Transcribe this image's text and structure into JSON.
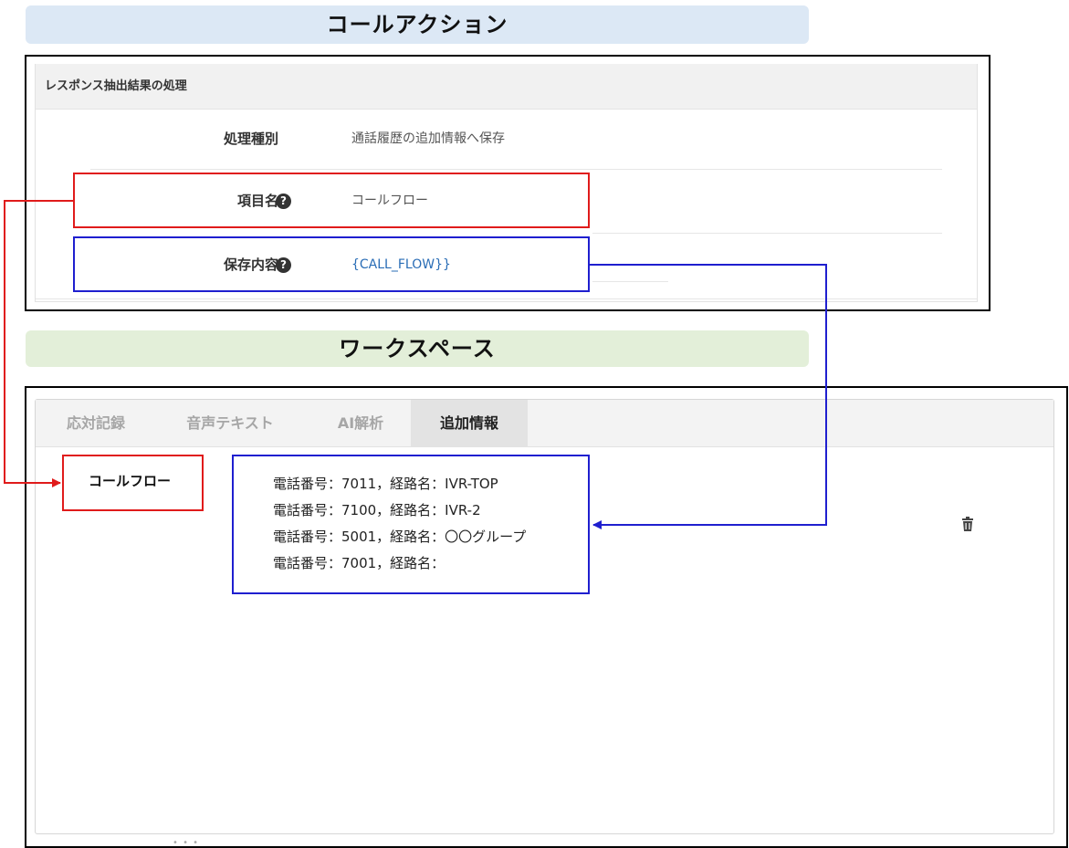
{
  "banners": {
    "call_action": "コールアクション",
    "workspace": "ワークスペース"
  },
  "settings": {
    "header": "レスポンス抽出結果の処理",
    "rows": [
      {
        "label": "処理種別",
        "value": "通話履歴の追加情報へ保存"
      },
      {
        "label": "項目名",
        "value": "コールフロー",
        "help_icon": "question-circle-icon"
      },
      {
        "label": "保存内容",
        "value": "{CALL_FLOW}}",
        "help_icon": "question-circle-icon"
      }
    ]
  },
  "workspace": {
    "tabs": [
      {
        "label": "応対記録",
        "active": false
      },
      {
        "label": "音声テキスト",
        "active": false
      },
      {
        "label": "AI解析",
        "active": false
      },
      {
        "label": "追加情報",
        "active": true
      }
    ],
    "field_name": "コールフロー",
    "flow_lines": [
      "電話番号：7011，経路名：IVR-TOP",
      "電話番号：7100，経路名：IVR-2",
      "電話番号：5001，経路名：〇〇グループ",
      "電話番号：7001，経路名："
    ],
    "delete_icon": "trash-icon"
  },
  "colors": {
    "highlight_red": "#e01b1b",
    "highlight_blue": "#1f1fcf",
    "banner_blue": "#dce8f5",
    "banner_green": "#e3efd9",
    "link": "#2a6db6"
  }
}
